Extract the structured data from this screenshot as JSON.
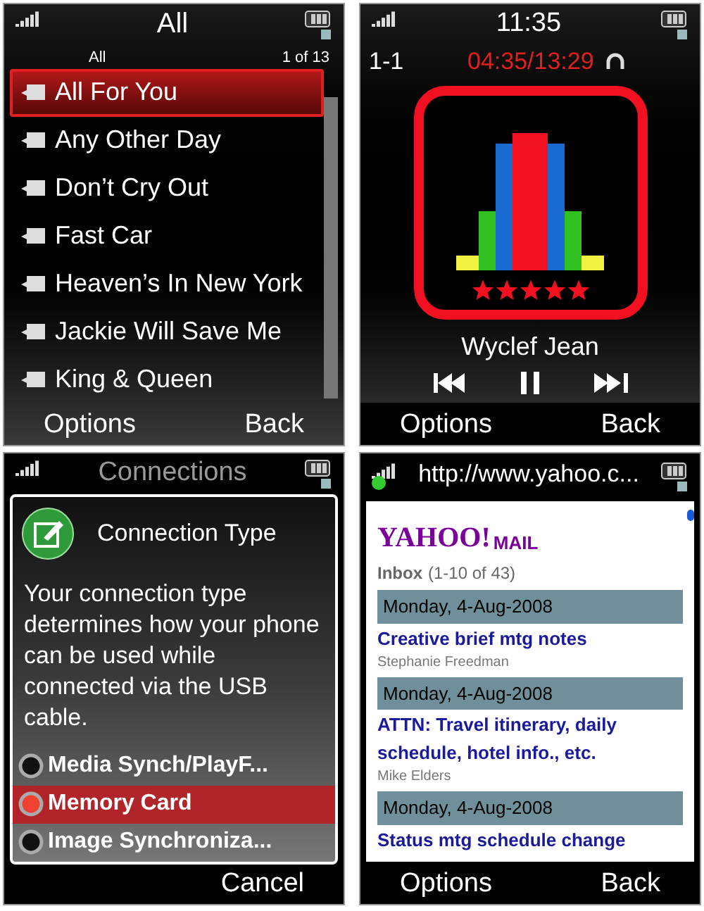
{
  "screens": [
    {
      "kind": "music_list",
      "title": "All",
      "subheader_left": "All",
      "subheader_right": "1 of 13",
      "songs": [
        {
          "title": "All For You",
          "selected": true
        },
        {
          "title": "Any Other Day",
          "selected": false
        },
        {
          "title": "Don’t Cry Out",
          "selected": false
        },
        {
          "title": "Fast Car",
          "selected": false
        },
        {
          "title": "Heaven’s In New York",
          "selected": false
        },
        {
          "title": "Jackie Will Save Me",
          "selected": false
        },
        {
          "title": "King & Queen",
          "selected": false
        }
      ],
      "softkeys": {
        "left": "Options",
        "right": "Back"
      }
    },
    {
      "kind": "now_playing",
      "time": "11:35",
      "track": "1-1",
      "progress_time": "04:35/13:29",
      "stars": 5,
      "artist": "Wyclef Jean",
      "softkeys": {
        "left": "Options",
        "right": "Back"
      }
    },
    {
      "kind": "dialog",
      "title": "Connections",
      "dialog_title": "Connection Type",
      "message": "Your connection type determines how your phone can be used while connected via the USB cable.",
      "options": [
        {
          "label": "Media Synch/PlayF...",
          "selected": false
        },
        {
          "label": "Memory Card",
          "selected": true
        },
        {
          "label": "Image Synchroniza...",
          "selected": false
        }
      ],
      "softkeys": {
        "right": "Cancel"
      }
    },
    {
      "kind": "browser",
      "url": "http://www.yahoo.c...",
      "logo": "YAHOO!",
      "logo_suffix": "MAIL",
      "inbox_label": "Inbox",
      "inbox_count": "(1-10 of 43)",
      "messages": [
        {
          "date": "Monday, 4-Aug-2008",
          "subject": "Creative brief mtg notes",
          "sender": "Stephanie Freedman"
        },
        {
          "date": "Monday, 4-Aug-2008",
          "subject": "ATTN: Travel itinerary, daily schedule, hotel info., etc.",
          "sender": "Mike Elders"
        },
        {
          "date": "Monday, 4-Aug-2008",
          "subject": "Status mtg schedule change"
        }
      ],
      "softkeys": {
        "left": "Options",
        "right": "Back"
      }
    }
  ]
}
